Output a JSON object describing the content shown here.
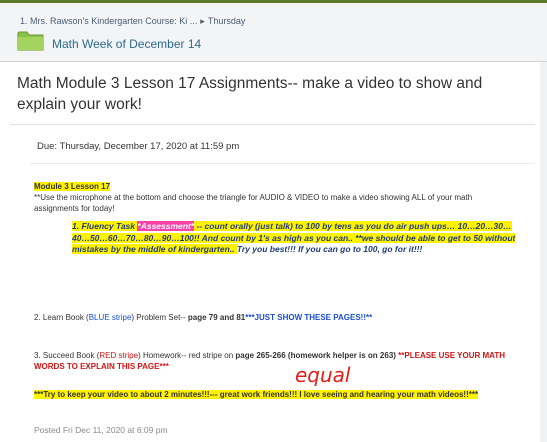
{
  "breadcrumb": {
    "course": "1. Mrs. Rawson's Kindergarten Course: Ki ...",
    "separator": "▸",
    "current": "Thursday"
  },
  "folder": {
    "icon": "folder-icon",
    "title": "Math Week of December 14",
    "color": "#8bc34a"
  },
  "assignment": {
    "title": "Math Module 3 Lesson 17 Assignments-- make a video to show and explain your work!",
    "due": "Due: Thursday, December 17, 2020 at 11:59 pm",
    "heading": "Module 3  Lesson 17",
    "intro": "**Use the microphone at the bottom and choose the triangle for AUDIO & VIDEO to make a video showing ALL of your math assignments for today!",
    "fluency": {
      "number": "1.",
      "label": "Fluency Task",
      "tag": "*Assessment*",
      "text": "--  count orally (just talk)  to 100 by tens as you do air push ups… 10…20…30…40…50…60…70…80…90…100!! And count by 1's as high as you can.. **we should be able to get to 50 without mistakes by the middle of kindergarten..",
      "encourage": "Try you best!!!  If you can go to 100, go for it!!!"
    },
    "item2": {
      "prefix": "2.  Learn Book (",
      "stripe": "BLUE stripe",
      "middle": ") Problem Set-- ",
      "pages": "page 79 and 81",
      "note": "***JUST SHOW THESE PAGES!!**"
    },
    "item3": {
      "prefix": "3.  Succeed Book (",
      "stripe": "RED stripe",
      "middle": ") Homework-- red stripe on ",
      "pages": "page 265-266 (homework helper is on 263)",
      "note": " **PLEASE USE YOUR MATH WORDS TO EXPLAIN THIS PAGE***"
    },
    "handwritten": "equal",
    "closing": "***Try to keep your video to about 2 minutes!!!--- great work friends!!!  I love seeing and hearing your math videos!!***",
    "posted": "Posted Fri Dec 11, 2020 at 6:09 pm"
  }
}
